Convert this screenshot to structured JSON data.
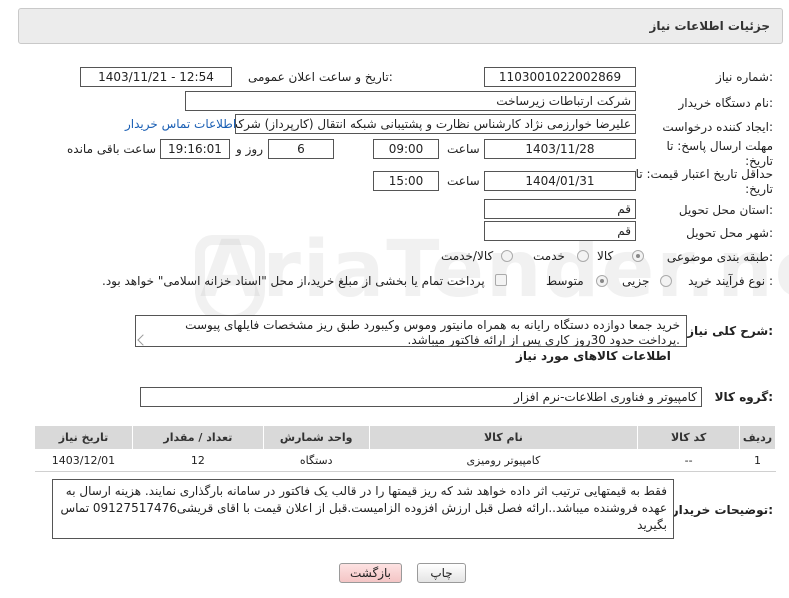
{
  "header": {
    "title": "جزئیات اطلاعات نیاز"
  },
  "watermark": {
    "text": "AriaTender.neT"
  },
  "fields": {
    "need_number": {
      "label": "شماره نیاز:",
      "value": "1103001022002869"
    },
    "announce_datetime": {
      "label": "تاریخ و ساعت اعلان عمومی:",
      "value": "1403/11/21 - 12:54"
    },
    "buyer_org": {
      "label": "نام دستگاه خریدار:",
      "value": "شرکت ارتباطات زیرساخت"
    },
    "requester": {
      "label": "ایجاد کننده درخواست:",
      "value": "علیرضا خوارزمی نژاد  کارشناس نظارت و پشتیبانی شبکه انتقال (کارپرداز) شرکت ارتباطات زیرساخت",
      "contact_link": "اطلاعات تماس خریدار"
    },
    "reply_deadline": {
      "label": "مهلت ارسال پاسخ: تا تاریخ:",
      "date": "1403/11/28",
      "time_label": "ساعت",
      "time": "09:00",
      "days": "6",
      "days_label": "روز و",
      "remaining": "19:16:01",
      "remaining_label": "ساعت باقی مانده"
    },
    "price_validity": {
      "label": "حداقل تاریخ اعتبار قیمت: تا تاریخ:",
      "date": "1404/01/31",
      "time_label": "ساعت",
      "time": "15:00"
    },
    "delivery_province": {
      "label": "استان محل تحویل:",
      "value": "قم"
    },
    "delivery_city": {
      "label": "شهر محل تحویل:",
      "value": "قم"
    },
    "category": {
      "label": "طبقه بندی موضوعی:",
      "options": [
        "کالا",
        "خدمت",
        "کالا/خدمت"
      ],
      "selected": "کالا"
    },
    "purchase_process": {
      "label": "نوع فرآیند خرید :",
      "options": [
        "جزیی",
        "متوسط"
      ],
      "selected": "متوسط",
      "note": "پرداخت تمام یا بخشی از مبلغ خرید،از محل \"اسناد خزانه اسلامی\" خواهد بود."
    }
  },
  "description": {
    "label": "شرح کلی نیاز:",
    "text": "خرید جمعا دوازده دستگاه رایانه به همراه مانیتور وموس وکیبورد طبق ریز مشخصات فایلهای پیوست .پرداخت حدود 30روز کاری پس از ارائه فاکتور میباشد."
  },
  "goods_info": {
    "title": "اطلاعات کالاهای مورد نیاز",
    "group_label": "گروه کالا:",
    "group_value": "کامپیوتر و فناوری اطلاعات-نرم افزار",
    "table": {
      "headers": [
        "ردیف",
        "کد کالا",
        "نام کالا",
        "واحد شمارش",
        "تعداد / مقدار",
        "تاریخ نیاز"
      ],
      "rows": [
        [
          "1",
          "--",
          "کامپیوتر رومیزی",
          "دستگاه",
          "12",
          "1403/12/01"
        ]
      ]
    }
  },
  "buyer_notes": {
    "label": "توضیحات خریدار:",
    "text": "فقط به قیمتهایی ترتیب اثر داده خواهد شد که ریز قیمتها را در قالب یک فاکتور در سامانه بارگذاری نمایند. هزینه ارسال به عهده فروشنده میباشد..ارائه فصل قبل ارزش افزوده الزامیست.قبل از اعلان قیمت با اقای قریشی09127517476 تماس بگیرید"
  },
  "buttons": {
    "print": "چاپ",
    "back": "بازگشت"
  }
}
